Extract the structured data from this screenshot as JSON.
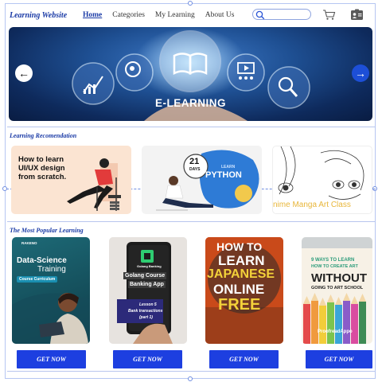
{
  "nav": {
    "brand": "Learning Website",
    "links": [
      "Home",
      "Categories",
      "My Learning",
      "About Us"
    ],
    "search_placeholder": ""
  },
  "hero": {
    "title": "E-LEARNING",
    "prev_icon": "arrow-left-icon",
    "next_icon": "arrow-right-icon",
    "slide_count": 4,
    "active_slide": 1
  },
  "recommendation": {
    "title": "Learning Recomendation",
    "cards": [
      {
        "text_line1": "How to learn",
        "text_line2": "UI/UX design",
        "text_line3": "from scratch."
      },
      {
        "badge_num": "21",
        "badge_sub": "DAYS",
        "small": "LEARN",
        "big": "PYTHON"
      },
      {
        "caption": "nime Manga Art Class"
      }
    ]
  },
  "popular": {
    "title": "The Most Popular Learning",
    "button_label": "GET NOW",
    "cards": [
      {
        "brand": "RAKENO",
        "title1": "Data-Science",
        "title2": "Training",
        "tag": "Course Curriculum"
      },
      {
        "label1": "Golang Course",
        "label2": "Banking App",
        "lesson1": "Lesson 5",
        "lesson2": "Bank transactions",
        "lesson3": "(part 1)",
        "app": "Golang Banking"
      },
      {
        "line1": "HOW TO",
        "line2": "LEARN",
        "line3": "JAPANESE",
        "line4": "ONLINE",
        "line5": "FREE"
      },
      {
        "line1": "9 WAYS TO LEARN",
        "line2": "HOW TO CREATE ART",
        "line3": "WITHOUT",
        "line4": "GOING TO ART SCHOOL",
        "logo": "ProofreadAppo"
      }
    ]
  },
  "colors": {
    "accent": "#1d3fe0",
    "brand": "#1b3ba6"
  }
}
